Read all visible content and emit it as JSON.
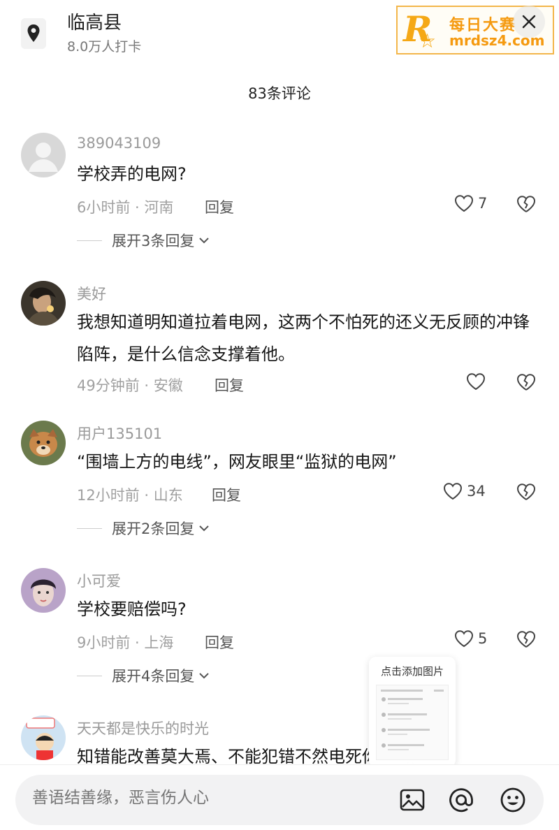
{
  "location": {
    "name": "临高县",
    "checkins": "8.0万人打卡",
    "icon": "location-pin-icon"
  },
  "watermark": {
    "text_cn": "每日大赛",
    "text_url": "mrdsz4.com"
  },
  "panel": {
    "title": "83条评论"
  },
  "comments": [
    {
      "user": "389043109",
      "text": "学校弄的电网?",
      "time_loc": "6小时前 · 河南",
      "reply": "回复",
      "likes": "7",
      "expand": "展开3条回复"
    },
    {
      "user": "美好",
      "text": "我想知道明知道拉着电网，这两个不怕死的还义无反顾的冲锋陷阵，是什么信念支撑着他。",
      "time_loc": "49分钟前 · 安徽",
      "reply": "回复",
      "likes": ""
    },
    {
      "user": "用户135101",
      "text": "“围墙上方的电线”，网友眼里“监狱的电网”",
      "time_loc": "12小时前 · 山东",
      "reply": "回复",
      "likes": "34",
      "expand": "展开2条回复"
    },
    {
      "user": "小可爱",
      "text": "学校要赔偿吗?",
      "time_loc": "9小时前 · 上海",
      "reply": "回复",
      "likes": "5",
      "expand": "展开4条回复"
    },
    {
      "user": "天天都是快乐的时光",
      "text": "知错能改善莫大焉、不能犯错不然电死你"
    }
  ],
  "popup": {
    "label": "点击添加图片"
  },
  "input": {
    "placeholder": "善语结善缘，恶言伤人心"
  },
  "colors": {
    "watermark": "#f5a815",
    "muted": "#a0a0a0",
    "text": "#151515"
  }
}
